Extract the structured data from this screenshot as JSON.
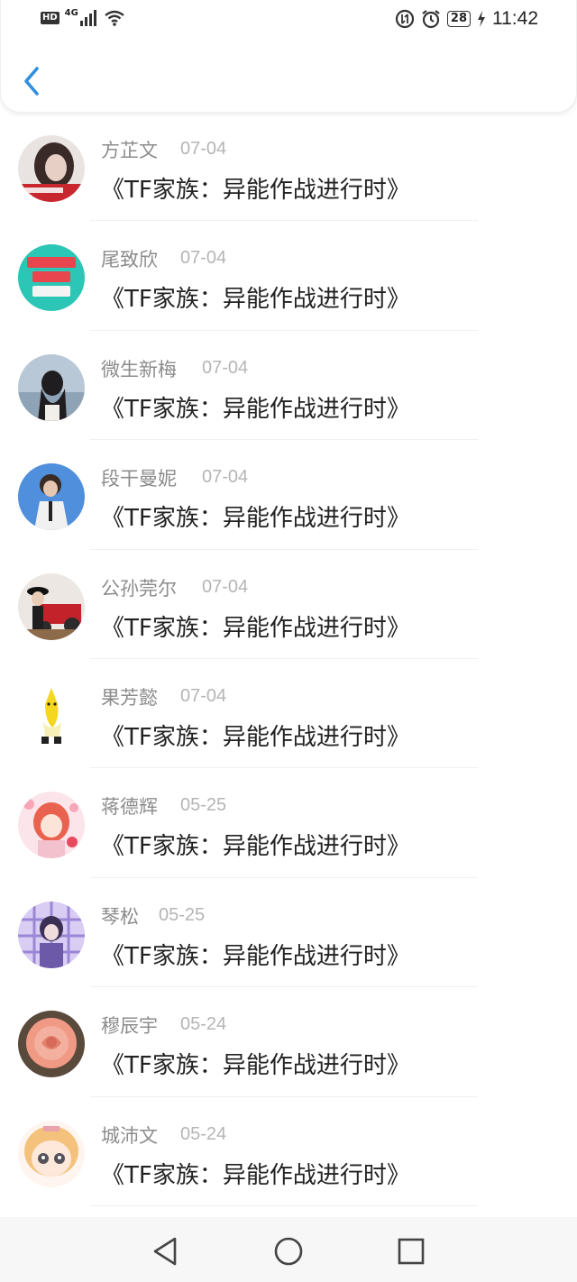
{
  "status_bar": {
    "hd": "HD",
    "network": "4G",
    "battery": "28",
    "time": "11:42"
  },
  "rows": [
    {
      "name": "方芷文",
      "date": "07-04",
      "message": "《TF家族：异能作战进行时》",
      "avatar": "girl-portrait-dark"
    },
    {
      "name": "尾致欣",
      "date": "07-04",
      "message": "《TF家族：异能作战进行时》",
      "avatar": "fuck-my-life-text"
    },
    {
      "name": "微生新梅",
      "date": "07-04",
      "message": "《TF家族：异能作战进行时》",
      "avatar": "girl-back-sea"
    },
    {
      "name": "段干曼妮",
      "date": "07-04",
      "message": "《TF家族：异能作战进行时》",
      "avatar": "boy-blue-sky"
    },
    {
      "name": "公孙莞尔",
      "date": "07-04",
      "message": "《TF家族：异能作战进行时》",
      "avatar": "person-red-tractor"
    },
    {
      "name": "果芳懿",
      "date": "07-04",
      "message": "《TF家族：异能作战进行时》",
      "avatar": "banana-cartoon"
    },
    {
      "name": "蒋德辉",
      "date": "05-25",
      "message": "《TF家族：异能作战进行时》",
      "avatar": "anime-girl-pink"
    },
    {
      "name": "琴松",
      "date": "05-25",
      "message": "《TF家族：异能作战进行时》",
      "avatar": "purple-plaid-figure"
    },
    {
      "name": "穆辰宇",
      "date": "05-24",
      "message": "《TF家族：异能作战进行时》",
      "avatar": "pink-rose"
    },
    {
      "name": "城沛文",
      "date": "05-24",
      "message": "《TF家族：异能作战进行时》",
      "avatar": "anime-chibi-face"
    }
  ],
  "colors": {
    "accent": "#2f8fe0",
    "name": "#8c8c8c",
    "date": "#b5b5b5",
    "message": "#222222"
  },
  "icons": {
    "back": "chevron-left-icon",
    "nav_back": "triangle-back-icon",
    "nav_home": "circle-home-icon",
    "nav_recent": "square-recent-icon"
  }
}
